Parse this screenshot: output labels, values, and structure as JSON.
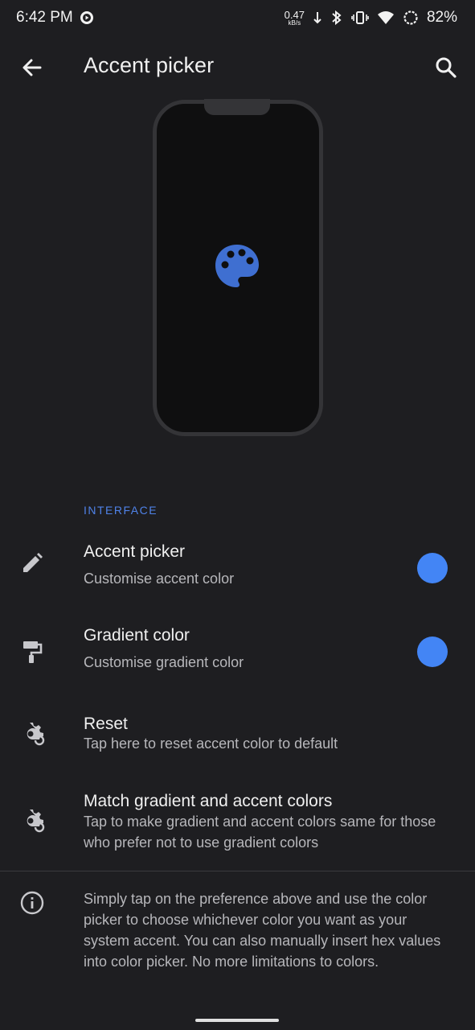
{
  "status_bar": {
    "time": "6:42 PM",
    "net_speed_value": "0.47",
    "net_speed_unit": "kB/s",
    "battery": "82%",
    "icons": [
      "media-icon",
      "download-arrow-icon",
      "bluetooth-icon",
      "vibrate-icon",
      "wifi-icon",
      "battery-saver-icon"
    ]
  },
  "app_bar": {
    "title": "Accent picker",
    "back_icon": "arrow-back-icon",
    "search_icon": "search-icon"
  },
  "preview": {
    "icon": "palette-icon",
    "icon_color": "#3f6fd1"
  },
  "section": {
    "header": "INTERFACE"
  },
  "preferences": [
    {
      "title": "Accent picker",
      "summary": "Customise accent color",
      "icon": "pencil-icon",
      "swatch": "#4385f5"
    },
    {
      "title": "Gradient color",
      "summary": "Customise gradient color",
      "icon": "paint-roller-icon",
      "swatch": "#4385f5"
    },
    {
      "title": "Reset",
      "summary": "Tap here to reset accent color to default",
      "icon": "settings-reset-icon"
    },
    {
      "title": "Match gradient and accent colors",
      "summary": "Tap to make gradient and accent colors same for those who prefer not to use gradient colors",
      "icon": "settings-reset-icon"
    }
  ],
  "info": {
    "icon": "info-icon",
    "text": "Simply tap on the preference above and use the color picker to choose whichever color you want as your system accent. You can also manually insert hex values into color picker. No more limitations to colors."
  },
  "colors": {
    "accent": "#4f82e8",
    "background": "#1e1e21"
  }
}
